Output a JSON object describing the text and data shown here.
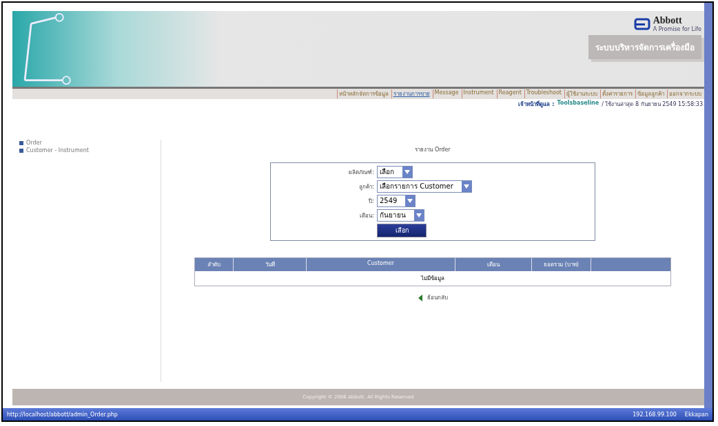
{
  "header": {
    "brand": "Abbott",
    "brand_tagline": "A Promise for Life",
    "system_title": "ระบบบริหารจัดการเครื่องมือ"
  },
  "nav": [
    {
      "label": "หน้าหลักจัดการข้อมูล",
      "selected": false
    },
    {
      "label": "รายงานการขาย",
      "selected": true
    },
    {
      "label": "Message",
      "selected": false
    },
    {
      "label": "Instrument",
      "selected": false
    },
    {
      "label": "Reagent",
      "selected": false
    },
    {
      "label": "Troubleshoot",
      "selected": false
    },
    {
      "label": "ผู้ใช้งานระบบ",
      "selected": false
    },
    {
      "label": "ตั้งค่ารายการ",
      "selected": false
    },
    {
      "label": "ข้อมูลลูกค้า",
      "selected": false
    },
    {
      "label": "ออกจากระบบ",
      "selected": false
    }
  ],
  "user_line": {
    "label": "เจ้าหน้าที่ดูแล :",
    "name": "Toolsbaseline",
    "date": "/ ใช้งานล่าสุด 8 กันยายน 2549 15:58:33"
  },
  "sidebar": {
    "items": [
      "Order",
      "Customer - Instrument"
    ]
  },
  "report": {
    "title": "รายงาน Order",
    "fields": [
      {
        "label": "ผลิตภัณฑ์:",
        "value": "เลือก"
      },
      {
        "label": "ลูกค้า:",
        "value": "เลือกรายการ Customer"
      },
      {
        "label": "ปี:",
        "value": "2549"
      },
      {
        "label": "เดือน:",
        "value": "กันยายน"
      }
    ],
    "submit": "เลือก"
  },
  "table": {
    "columns": [
      "ลำดับ",
      "วันที่",
      "Customer",
      "เดือน",
      "ยอดรวม (บาท)"
    ],
    "empty_message": "ไม่มีข้อมูล"
  },
  "back_link": "ย้อนกลับ",
  "footer": "Copyright © 2006 Abbott. All Rights Reserved",
  "status_bar": {
    "url": "http://localhost/abbott/admin_Order.php",
    "ip": "192.168.99.100",
    "user": "Ekkapan"
  }
}
